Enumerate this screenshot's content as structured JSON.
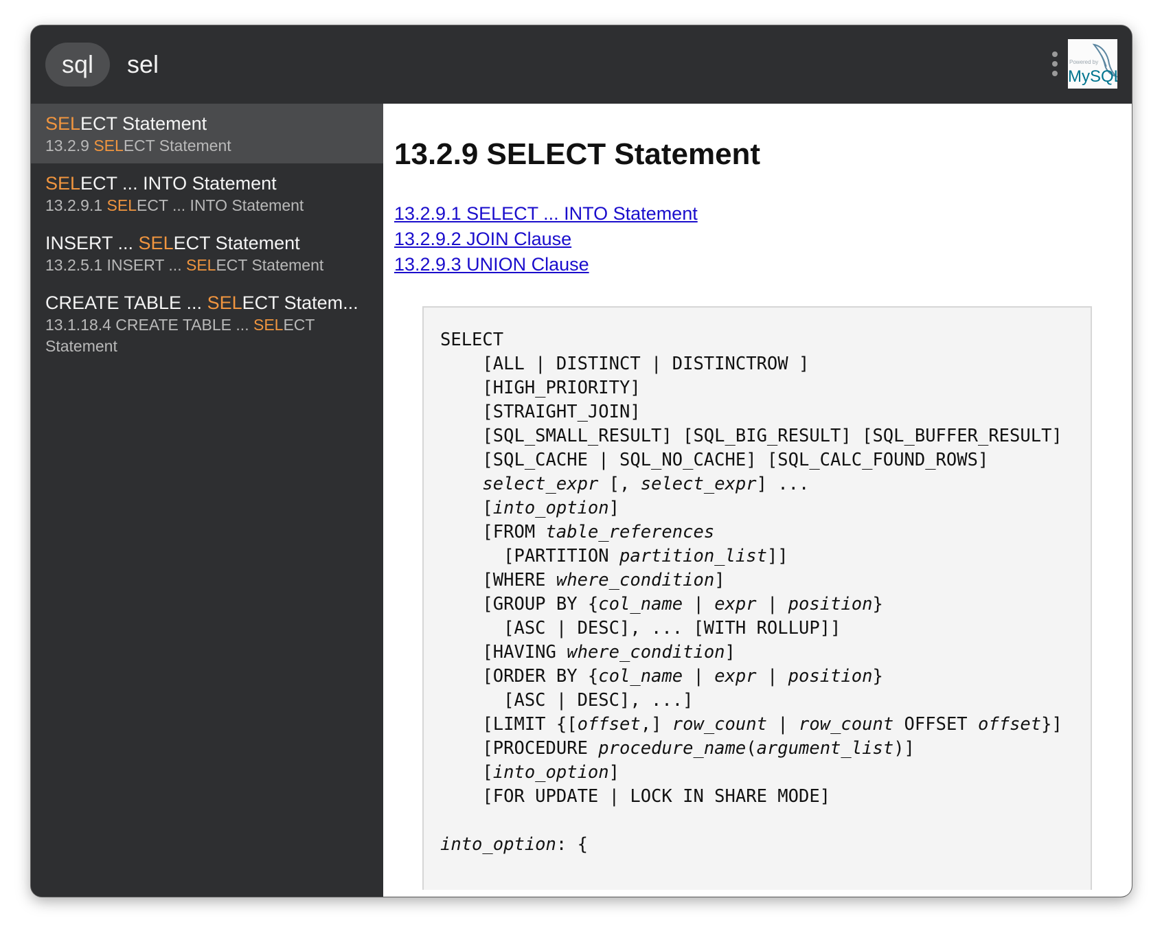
{
  "search": {
    "keyword": "sql",
    "query": "sel"
  },
  "logo": {
    "text_small": "Powered by",
    "text_big": "MySQL"
  },
  "results": [
    {
      "title_hl": "SEL",
      "title_rest": "ECT Statement",
      "sub_pre": "13.2.9 ",
      "sub_hl": "SEL",
      "sub_post": "ECT Statement"
    },
    {
      "title_hl": "SEL",
      "title_rest": "ECT ... INTO Statement",
      "sub_pre": "13.2.9.1 ",
      "sub_hl": "SEL",
      "sub_post": "ECT ... INTO Statement"
    },
    {
      "title_pre": "INSERT ... ",
      "title_hl": "SEL",
      "title_rest": "ECT Statement",
      "sub_pre": "13.2.5.1 INSERT ... ",
      "sub_hl": "SEL",
      "sub_post": "ECT Statement"
    },
    {
      "title_pre": "CREATE TABLE ... ",
      "title_hl": "SEL",
      "title_rest": "ECT Statem...",
      "sub_pre": "13.1.18.4 CREATE TABLE ... ",
      "sub_hl": "SEL",
      "sub_post": "ECT",
      "sub_line2": "Statement"
    }
  ],
  "content": {
    "title": "13.2.9 SELECT Statement",
    "toc": [
      "13.2.9.1 SELECT ... INTO Statement",
      "13.2.9.2 JOIN Clause",
      "13.2.9.3 UNION Clause"
    ],
    "code_lines": [
      "SELECT",
      "    [ALL | DISTINCT | DISTINCTROW ]",
      "    [HIGH_PRIORITY]",
      "    [STRAIGHT_JOIN]",
      "    [SQL_SMALL_RESULT] [SQL_BIG_RESULT] [SQL_BUFFER_RESULT]",
      "    [SQL_CACHE | SQL_NO_CACHE] [SQL_CALC_FOUND_ROWS]",
      "    *select_expr* [, *select_expr*] ...",
      "    [*into_option*]",
      "    [FROM *table_references*",
      "      [PARTITION *partition_list*]]",
      "    [WHERE *where_condition*]",
      "    [GROUP BY {*col_name* | *expr* | *position*}",
      "      [ASC | DESC], ... [WITH ROLLUP]]",
      "    [HAVING *where_condition*]",
      "    [ORDER BY {*col_name* | *expr* | *position*}",
      "      [ASC | DESC], ...]",
      "    [LIMIT {[*offset*,] *row_count* | *row_count* OFFSET *offset*}]",
      "    [PROCEDURE *procedure_name*(*argument_list*)]",
      "    [*into_option*]",
      "    [FOR UPDATE | LOCK IN SHARE MODE]",
      "",
      "*into_option*: {"
    ]
  }
}
